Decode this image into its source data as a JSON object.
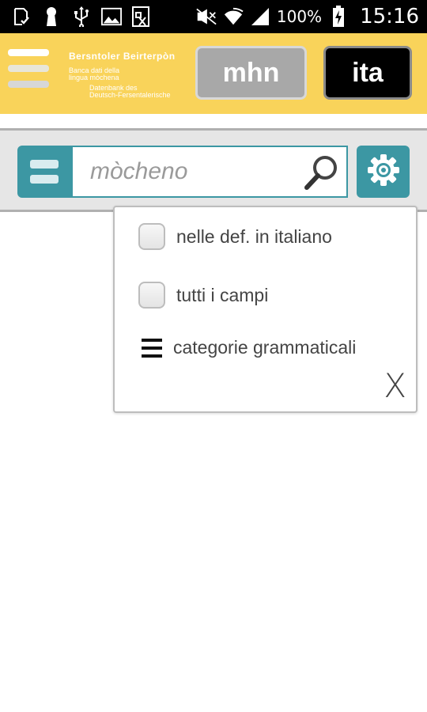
{
  "status_bar": {
    "battery_percent": "100%",
    "time": "15:16",
    "icons": [
      "download-done-icon",
      "keyhole-icon",
      "usb-icon",
      "image-icon",
      "rx-icon",
      "no-sound-icon",
      "wifi-icon",
      "signal-icon",
      "battery-charging-icon"
    ]
  },
  "header": {
    "logo_title": "Bersntoler Beirterpòn",
    "logo_line_1": "Banca dati della",
    "logo_line_2": "lingua mòchena",
    "logo_line_3": "Datenbank des",
    "logo_line_4": "Deutsch-Fersentalerische",
    "logo_bar_colors": [
      "#ffffff",
      "#e8e6d8",
      "#d7d7d7"
    ],
    "lang_buttons": [
      {
        "label": "mhn",
        "active": false
      },
      {
        "label": "ita",
        "active": true
      }
    ]
  },
  "search": {
    "placeholder": "mòcheno",
    "accent_color": "#3c97a3"
  },
  "dropdown": {
    "options": [
      {
        "label": "nelle def. in italiano",
        "checked": false
      },
      {
        "label": "tutti i campi",
        "checked": false
      }
    ],
    "categories_label": "categorie grammaticali",
    "close_label": "X"
  }
}
